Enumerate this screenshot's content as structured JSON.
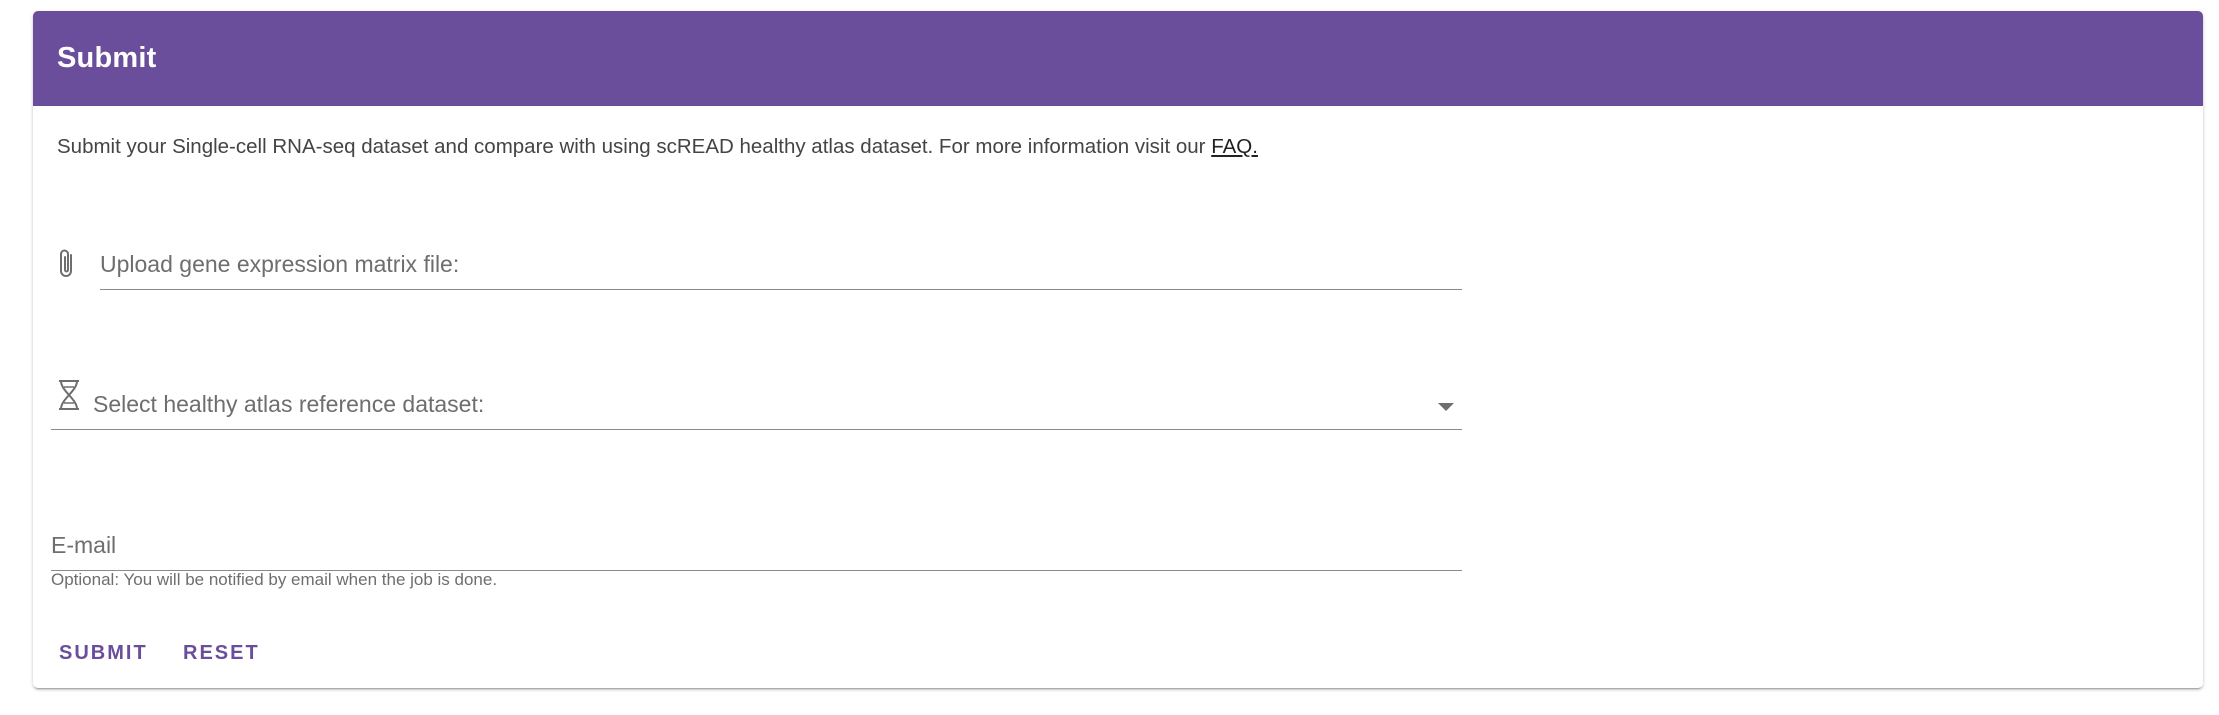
{
  "card": {
    "title": "Submit",
    "intro_text": "Submit your Single-cell RNA-seq dataset and compare with using scREAD healthy atlas dataset. For more information visit our ",
    "intro_link": "FAQ."
  },
  "form": {
    "upload": {
      "label": "Upload gene expression matrix file:",
      "icon": "paperclip-icon"
    },
    "reference": {
      "label": "Select healthy atlas reference dataset:",
      "icon": "dna-icon",
      "dropdown_icon": "caret-down-icon"
    },
    "email": {
      "label": "E-mail",
      "hint": "Optional: You will be notified by email when the job is done."
    }
  },
  "actions": {
    "submit_label": "SUBMIT",
    "reset_label": "RESET"
  },
  "colors": {
    "primary": "#6a4e9c",
    "text": "#444444",
    "muted": "#6e6e6e"
  }
}
